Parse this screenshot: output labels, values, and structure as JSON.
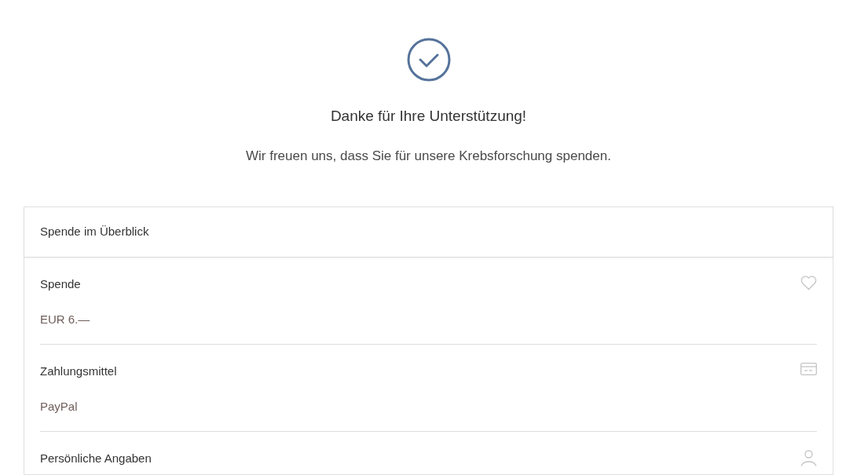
{
  "confirmation": {
    "title": "Danke für Ihre Unterstützung!",
    "message": "Wir freuen uns, dass Sie für unsere Krebsforschung spenden."
  },
  "summary": {
    "heading": "Spende im Überblick",
    "sections": [
      {
        "kind": "donation",
        "label": "Spende",
        "value": "EUR 6.—"
      },
      {
        "kind": "payment",
        "label": "Zahlungsmittel",
        "value": "PayPal"
      },
      {
        "kind": "personal",
        "label": "Persönliche Angaben"
      }
    ]
  }
}
